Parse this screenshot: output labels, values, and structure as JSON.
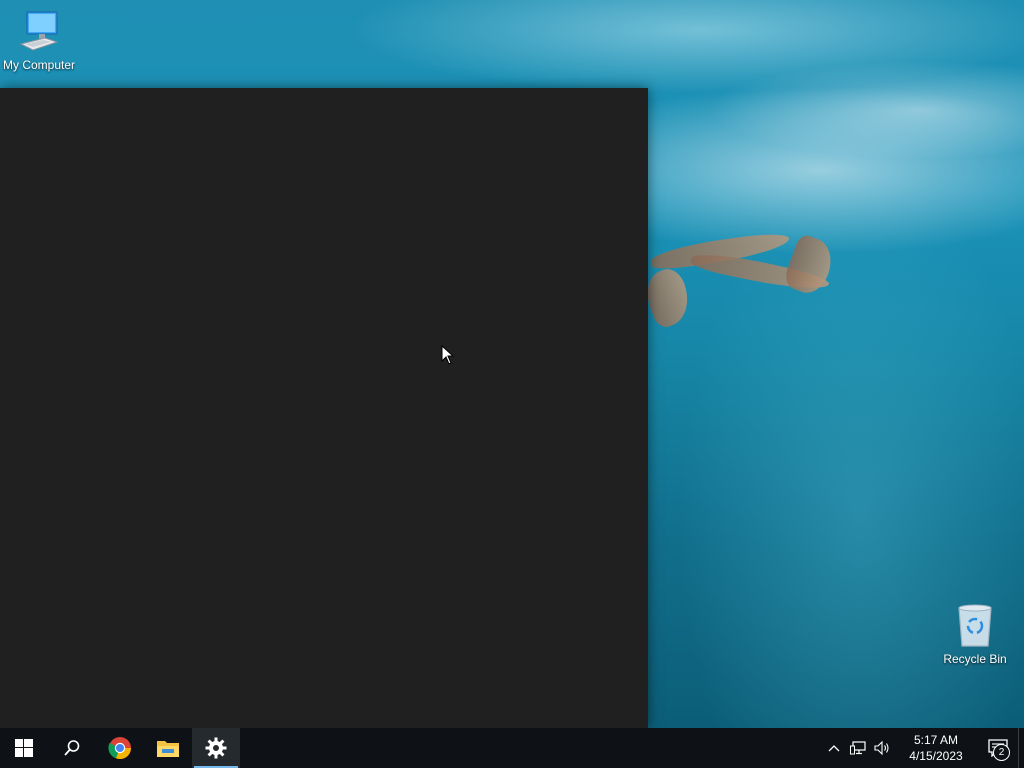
{
  "desktop": {
    "icons": [
      {
        "label": "My Computer",
        "icon": "monitor-icon"
      },
      {
        "label": "Recycle Bin",
        "icon": "recycle-bin-icon"
      }
    ]
  },
  "taskbar": {
    "items": [
      {
        "name": "start",
        "icon": "windows-logo-icon",
        "active": false
      },
      {
        "name": "search",
        "icon": "search-icon",
        "active": false
      },
      {
        "name": "chrome",
        "icon": "chrome-icon",
        "active": false
      },
      {
        "name": "file-explorer",
        "icon": "folder-icon",
        "active": false
      },
      {
        "name": "settings",
        "icon": "gear-icon",
        "active": true
      }
    ],
    "tray": {
      "icons": [
        "chevron-up-icon",
        "network-icon",
        "volume-icon"
      ],
      "time": "5:17 AM",
      "date": "4/15/2023",
      "notification_count": "2"
    }
  },
  "colors": {
    "window_bg": "#202020",
    "taskbar_bg": "#0e1216",
    "accent": "#76b9ed"
  }
}
